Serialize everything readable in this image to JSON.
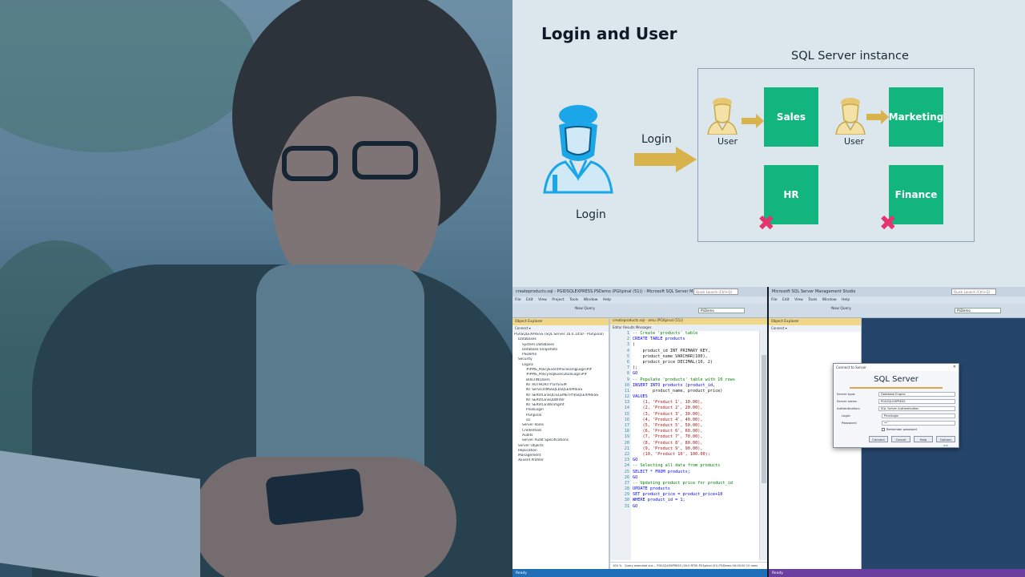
{
  "slide": {
    "title": "Login and User",
    "instance_label": "SQL Server instance",
    "login_arrow_label": "Login",
    "login_person_label": "Login",
    "user_label_1": "User",
    "user_label_2": "User",
    "db_sales": "Sales",
    "db_marketing": "Marketing",
    "db_hr": "HR",
    "db_finance": "Finance",
    "colors": {
      "db": "#13b57f",
      "arrow": "#d8b24a",
      "denied": "#e4336e",
      "login_icon": "#1aa6e8"
    }
  },
  "ssms_left": {
    "title": "createproducts.sql - PGIDSQLEXPRESS.PSDemo (PGI\\pinal (51)) - Microsoft SQL Server Management Studio",
    "quick_launch": "Quick Launch (Ctrl+Q)",
    "menu": [
      "File",
      "Edit",
      "View",
      "Project",
      "Tools",
      "Window",
      "Help"
    ],
    "new_query": "New Query",
    "database": "PSDemo",
    "object_explorer": {
      "title": "Object Explorer",
      "toolbar": "Connect ▾",
      "nodes": [
        "PGI\\SQLEXPRESS (SQL Server 16.0.1050 - PGI\\pinal)",
        "Databases",
        "System Databases",
        "Database Snapshots",
        "PSDemo",
        "Security",
        "Logins",
        "##MS_PolicyEventProcessingLogin##",
        "##MS_PolicyTsqlExecutionLogin##",
        "BUILTIN\\Users",
        "NT AUTHORITY\\SYSTEM",
        "NT Service\\MSSQL$SQLEXPRESS",
        "NT SERVICE\\SQLTELEMETRY$SQLEXPRESS",
        "NT SERVICE\\SQLWriter",
        "NT SERVICE\\Winmgmt",
        "PinalLogin",
        "PGI\\pinal",
        "sa",
        "Server Roles",
        "Credentials",
        "Audits",
        "Server Audit Specifications",
        "Server Objects",
        "Replication",
        "Management",
        "XEvent Profiler"
      ]
    },
    "editor": {
      "tab": "createproducts.sql - amu (PGI\\pinal (51))",
      "subtabs": "Editor  Results  Messages",
      "code": [
        "-- Create 'products' table",
        "CREATE TABLE products",
        "(",
        "    product_id INT PRIMARY KEY,",
        "    product_name VARCHAR(100),",
        "    product_price DECIMAL(10, 2)",
        ");",
        "GO",
        "-- Populate 'products' table with 10 rows",
        "INSERT INTO products (product_id,",
        "        product_name, product_price)",
        "VALUES",
        "    (1, 'Product 1', 10.00),",
        "    (2, 'Product 2', 20.00),",
        "    (3, 'Product 3', 30.00),",
        "    (4, 'Product 4', 40.00),",
        "    (5, 'Product 5', 50.00),",
        "    (6, 'Product 6', 60.00),",
        "    (7, 'Product 7', 70.00),",
        "    (8, 'Product 8', 80.00),",
        "    (9, 'Product 9', 90.00),",
        "    (10, 'Product 10', 100.00);",
        "GO",
        "-- Selecting all data from products",
        "SELECT * FROM products;",
        "GO",
        "-- Updating product price for product_id",
        "UPDATE products",
        "SET product_price = product_price+10",
        "WHERE product_id = 1;",
        "GO"
      ],
      "zoom": "100 %",
      "status": "Query executed suc...   PGI\\SQLEXPRESS (16.0 RTM)   PGI\\pinal (51)   PSDemo   00:00:00   10 rows"
    },
    "statusbar": "Ready"
  },
  "ssms_right": {
    "title": "Microsoft SQL Server Management Studio",
    "quick_launch": "Quick Launch (Ctrl+Q)",
    "menu": [
      "File",
      "Edit",
      "View",
      "Tools",
      "Window",
      "Help"
    ],
    "new_query": "New Query",
    "database": "PSDemo",
    "object_explorer": {
      "title": "Object Explorer",
      "toolbar": "Connect ▾"
    },
    "dialog": {
      "title": "Connect to Server",
      "brand": "SQL Server",
      "server_type_label": "Server type:",
      "server_type": "Database Engine",
      "server_name_label": "Server name:",
      "server_name": "PGI\\SQLEXPRESS",
      "auth_label": "Authentication:",
      "auth": "SQL Server Authentication",
      "login_label": "Login:",
      "login": "PinalLogin",
      "password_label": "Password:",
      "password": "••",
      "remember": "Remember password",
      "btn_connect": "Connect",
      "btn_cancel": "Cancel",
      "btn_help": "Help",
      "btn_options": "Options >>"
    },
    "statusbar": "Ready"
  }
}
